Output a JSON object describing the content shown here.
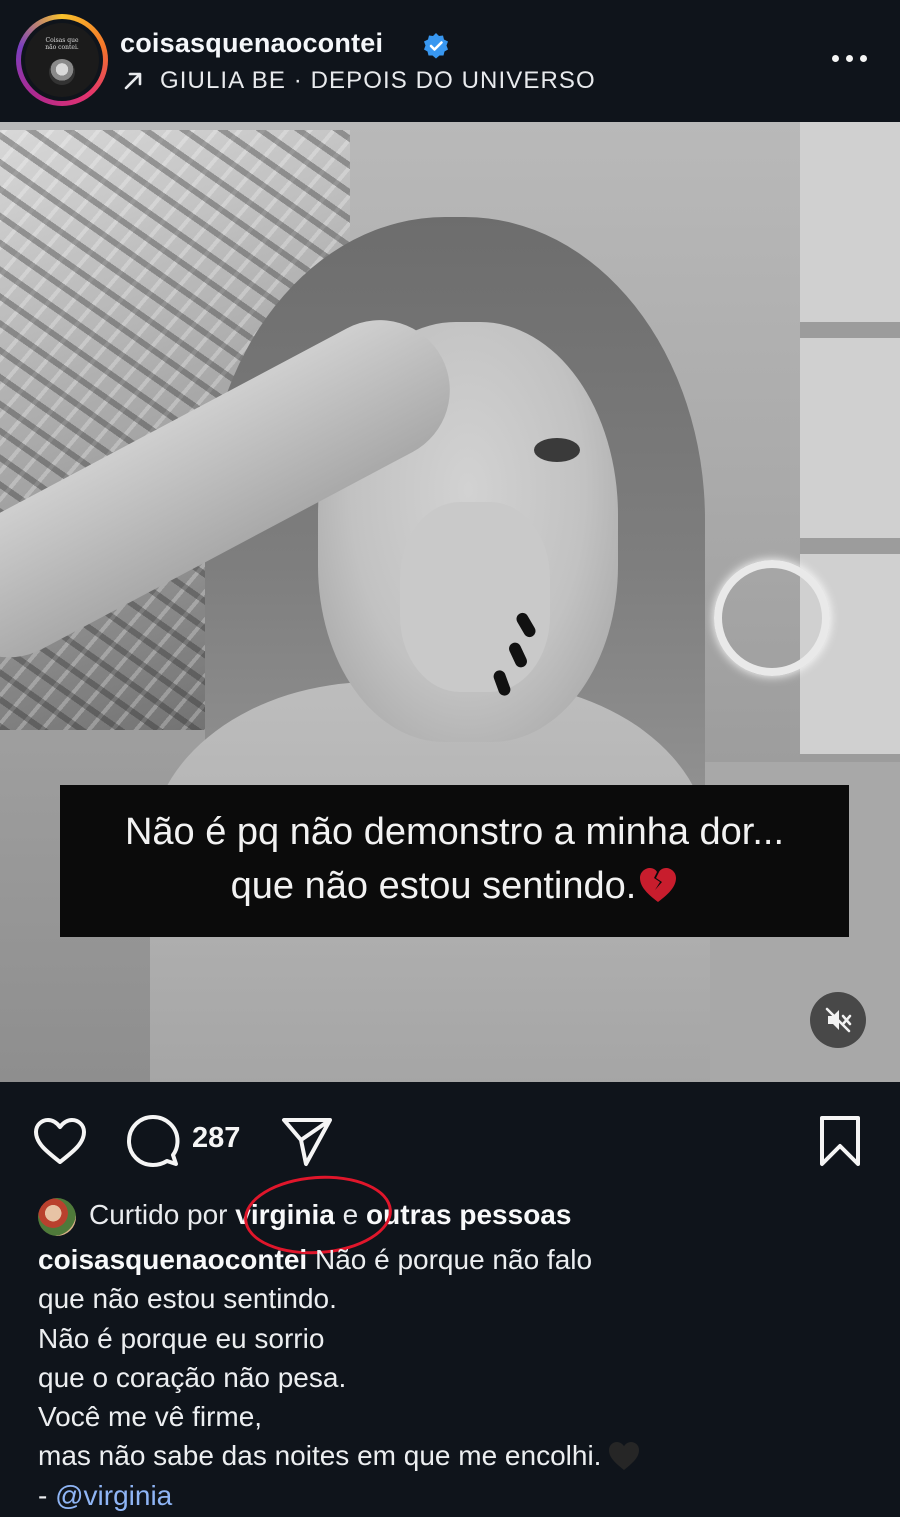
{
  "header": {
    "username": "coisasquenaocontei",
    "avatar_text": "Coisas que\nnão contei.",
    "music": "GIULIA BE · DEPOIS DO UNIVERSO"
  },
  "media": {
    "caption_line1": "Não é pq não demonstro a minha dor...",
    "caption_line2": "que não estou sentindo."
  },
  "actions": {
    "comment_count": "287"
  },
  "likes": {
    "prefix": "Curtido por ",
    "user": "virginia",
    "conj": " e ",
    "others": "outras pessoas"
  },
  "caption": {
    "author": "coisasquenaocontei",
    "line1": " Não é porque não falo",
    "line2": "que não estou sentindo.",
    "line3": "Não é porque eu sorrio",
    "line4": "que o coração não pesa.",
    "line5": "Você me vê firme,",
    "line6": "mas não sabe das noites em que me encolhi.",
    "credit_prefix": "- ",
    "mention": "@virginia"
  },
  "colors": {
    "background": "#0f141b",
    "verified_blue": "#3897f0",
    "annotation_red": "#e0162b",
    "mention_blue": "#8fb5f5"
  },
  "icons": [
    "verified-badge-icon",
    "arrow-up-right-icon",
    "more-icon",
    "broken-heart-icon",
    "mute-icon",
    "heart-icon",
    "comment-icon",
    "send-icon",
    "bookmark-icon",
    "black-heart-icon"
  ]
}
